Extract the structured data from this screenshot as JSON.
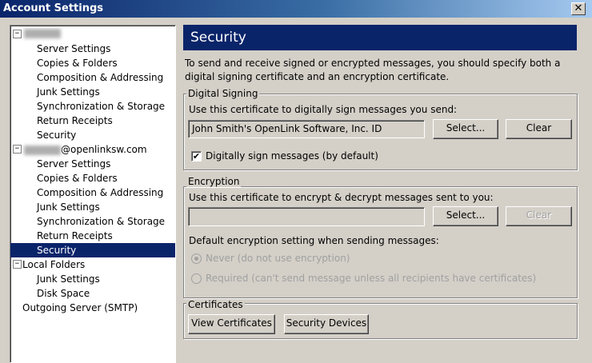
{
  "window": {
    "title": "Account Settings",
    "close_glyph": "✕"
  },
  "tree": {
    "account1": {
      "label": ""
    },
    "account1_items": [
      "Server Settings",
      "Copies & Folders",
      "Composition & Addressing",
      "Junk Settings",
      "Synchronization & Storage",
      "Return Receipts",
      "Security"
    ],
    "account2": {
      "label": "@openlinksw.com"
    },
    "account2_items": [
      "Server Settings",
      "Copies & Folders",
      "Composition & Addressing",
      "Junk Settings",
      "Synchronization & Storage",
      "Return Receipts",
      "Security"
    ],
    "local_folders": {
      "label": "Local Folders"
    },
    "local_items": [
      "Junk Settings",
      "Disk Space"
    ],
    "outgoing": {
      "label": "Outgoing Server (SMTP)"
    },
    "expander_glyph": "−"
  },
  "panel": {
    "title": "Security",
    "description": "To send and receive signed or encrypted messages, you should specify both a digital signing certificate and an encryption certificate.",
    "signing": {
      "label": "Digital Signing",
      "instruction": "Use this certificate to digitally sign messages you send:",
      "certificate": "John Smith's OpenLink Software, Inc. ID",
      "select_label": "Select...",
      "clear_label": "Clear",
      "sign_checkbox_label": "Digitally sign messages (by default)",
      "sign_checked": true
    },
    "encryption": {
      "label": "Encryption",
      "instruction": "Use this certificate to encrypt & decrypt messages sent to you:",
      "certificate": "",
      "select_label": "Select...",
      "clear_label": "Clear",
      "default_label": "Default encryption setting when sending messages:",
      "radio_never": "Never (do not use encryption)",
      "radio_required": "Required (can't send message unless all recipients have certificates)",
      "selected": "never"
    },
    "certificates": {
      "label": "Certificates",
      "view_label": "View Certificates",
      "devices_label": "Security Devices"
    }
  },
  "colors": {
    "selection": "#0a246a",
    "face": "#d4d0c8"
  }
}
